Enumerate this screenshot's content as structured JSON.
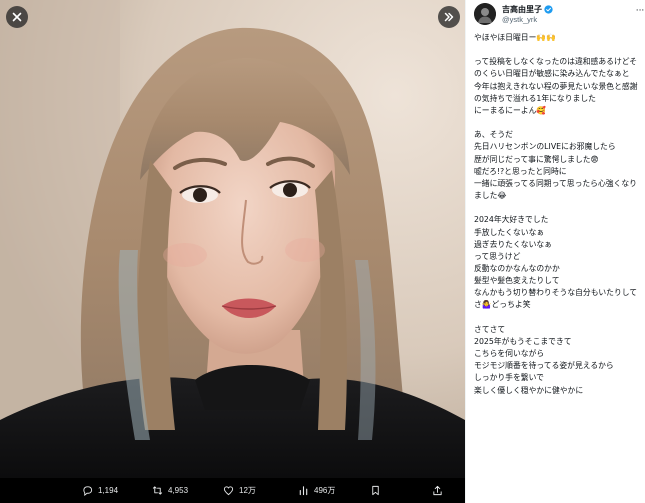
{
  "viewer": {
    "close_icon": "close-icon",
    "next_icon": "chevron-right-icon"
  },
  "actions": {
    "reply_count": "1,194",
    "retweet_count": "4,953",
    "like_count": "12万",
    "view_count": "496万"
  },
  "tweet": {
    "author_name": "吉高由里子",
    "author_handle": "@ystk_yrk",
    "verified": true,
    "text": "やほやほ日曜日ー🙌🙌\n\nって投稿をしなくなったのは違和感あるけどそのくらい日曜日が敏感に染み込んでたなぁと\n今年は抱えきれない程の夢見たいな景色と感謝の気持ちで溢れる1年になりました\nにーまるにーよん🥰\n\nあ、そうだ\n先日ハリセンボンのLIVEにお邪魔したら\n歴が同じだって事に驚愕しました😨\n嘘だろ!?と思ったと同時に\n一緒に頑張ってる同期って思ったら心強くなりました😂\n\n2024年大好きでした\n手放したくないなぁ\n過ぎ去りたくないなぁ\nって思うけど\n反動なのかなんなのかか\n髪型や髪色変えたりして\nなんかもう切り替わりそうな自分もいたりしてさ🤷‍♀️どっちよ笑\n\nさてさて\n2025年がもうそこまできて\nこちらを伺いながら\nモジモジ順番を待ってる姿が見えるから\nしっかり手を繋いで\n楽しく優しく穏やかに健やかに"
  },
  "colors": {
    "viewer_bg": "#000000",
    "panel_bg": "#ffffff",
    "text": "#0f1419",
    "muted": "#536471",
    "verified": "#1d9bf0"
  }
}
